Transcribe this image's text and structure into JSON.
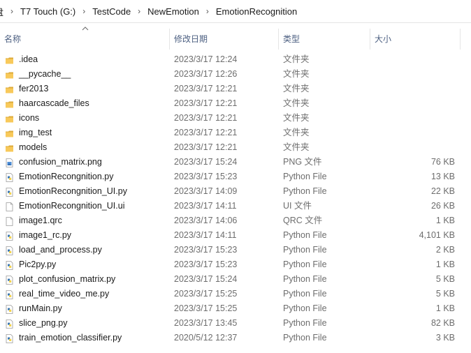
{
  "breadcrumb": {
    "items": [
      "盘",
      "T7 Touch (G:)",
      "TestCode",
      "NewEmotion",
      "EmotionRecognition"
    ]
  },
  "columns": {
    "name": "名称",
    "modified": "修改日期",
    "type": "类型",
    "size": "大小"
  },
  "files": [
    {
      "name": ".idea",
      "modified": "2023/3/17 12:24",
      "type": "文件夹",
      "size": "",
      "icon": "folder-icon"
    },
    {
      "name": "__pycache__",
      "modified": "2023/3/17 12:26",
      "type": "文件夹",
      "size": "",
      "icon": "folder-icon"
    },
    {
      "name": "fer2013",
      "modified": "2023/3/17 12:21",
      "type": "文件夹",
      "size": "",
      "icon": "folder-icon"
    },
    {
      "name": "haarcascade_files",
      "modified": "2023/3/17 12:21",
      "type": "文件夹",
      "size": "",
      "icon": "folder-icon"
    },
    {
      "name": "icons",
      "modified": "2023/3/17 12:21",
      "type": "文件夹",
      "size": "",
      "icon": "folder-icon"
    },
    {
      "name": "img_test",
      "modified": "2023/3/17 12:21",
      "type": "文件夹",
      "size": "",
      "icon": "folder-icon"
    },
    {
      "name": "models",
      "modified": "2023/3/17 12:21",
      "type": "文件夹",
      "size": "",
      "icon": "folder-icon"
    },
    {
      "name": "confusion_matrix.png",
      "modified": "2023/3/17 15:24",
      "type": "PNG 文件",
      "size": "76 KB",
      "icon": "image-file-icon"
    },
    {
      "name": "EmotionRecongnition.py",
      "modified": "2023/3/17 15:23",
      "type": "Python File",
      "size": "13 KB",
      "icon": "python-file-icon"
    },
    {
      "name": "EmotionRecongnition_UI.py",
      "modified": "2023/3/17 14:09",
      "type": "Python File",
      "size": "22 KB",
      "icon": "python-file-icon"
    },
    {
      "name": "EmotionRecongnition_UI.ui",
      "modified": "2023/3/17 14:11",
      "type": "UI 文件",
      "size": "26 KB",
      "icon": "blank-file-icon"
    },
    {
      "name": "image1.qrc",
      "modified": "2023/3/17 14:06",
      "type": "QRC 文件",
      "size": "1 KB",
      "icon": "blank-file-icon"
    },
    {
      "name": "image1_rc.py",
      "modified": "2023/3/17 14:11",
      "type": "Python File",
      "size": "4,101 KB",
      "icon": "python-file-icon"
    },
    {
      "name": "load_and_process.py",
      "modified": "2023/3/17 15:23",
      "type": "Python File",
      "size": "2 KB",
      "icon": "python-file-icon"
    },
    {
      "name": "Pic2py.py",
      "modified": "2023/3/17 15:23",
      "type": "Python File",
      "size": "1 KB",
      "icon": "python-file-icon"
    },
    {
      "name": "plot_confusion_matrix.py",
      "modified": "2023/3/17 15:24",
      "type": "Python File",
      "size": "5 KB",
      "icon": "python-file-icon"
    },
    {
      "name": "real_time_video_me.py",
      "modified": "2023/3/17 15:25",
      "type": "Python File",
      "size": "5 KB",
      "icon": "python-file-icon"
    },
    {
      "name": "runMain.py",
      "modified": "2023/3/17 15:25",
      "type": "Python File",
      "size": "1 KB",
      "icon": "python-file-icon"
    },
    {
      "name": "slice_png.py",
      "modified": "2023/3/17 13:45",
      "type": "Python File",
      "size": "82 KB",
      "icon": "python-file-icon"
    },
    {
      "name": "train_emotion_classifier.py",
      "modified": "2020/5/12 12:37",
      "type": "Python File",
      "size": "3 KB",
      "icon": "python-file-icon"
    }
  ],
  "colors": {
    "folder": "#f8c95a",
    "header_text": "#4d6082",
    "python_blue": "#3a76b0",
    "python_yellow": "#f5d34a"
  }
}
